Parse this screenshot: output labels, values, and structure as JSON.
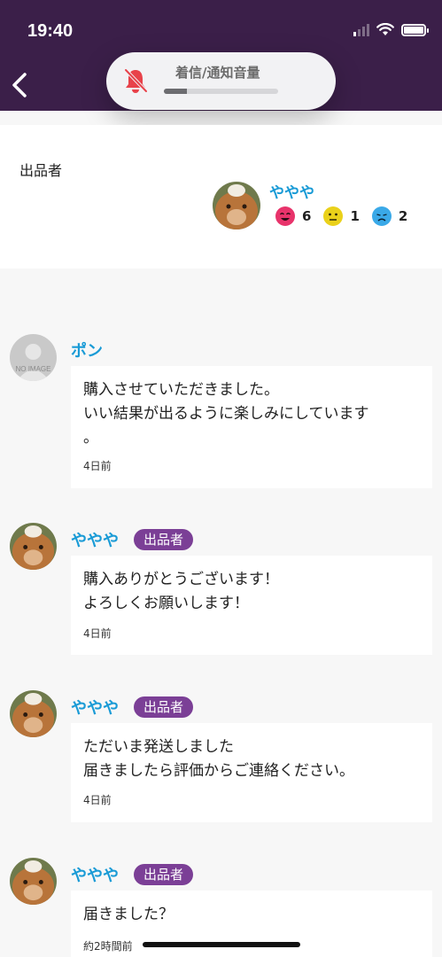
{
  "status_bar": {
    "time": "19:40"
  },
  "volume_hud": {
    "label": "着信/通知音量",
    "level": 0.2
  },
  "seller": {
    "label": "出品者",
    "name": "ややや",
    "ratings": [
      {
        "kind": "good",
        "icon": "smile-face-icon",
        "color": "#e8336b",
        "count": "6"
      },
      {
        "kind": "normal",
        "icon": "neutral-face-icon",
        "color": "#ead11a",
        "count": "1"
      },
      {
        "kind": "bad",
        "icon": "sad-face-icon",
        "color": "#3aa9e8",
        "count": "2"
      }
    ]
  },
  "messages": [
    {
      "name": "ポン",
      "badge": "",
      "avatar_text": "NO IMAGE",
      "text": "購入させていただきました。\nいい結果が出るように楽しみにしています\n。",
      "time": "4日前"
    },
    {
      "name": "ややや",
      "badge": "出品者",
      "text": "購入ありがとうございます！\nよろしくお願いします！",
      "time": "4日前"
    },
    {
      "name": "ややや",
      "badge": "出品者",
      "text": "ただいま発送しました\n届きましたら評価からご連絡ください。",
      "time": "4日前"
    },
    {
      "name": "ややや",
      "badge": "出品者",
      "text": "届きました？",
      "time": "約2時間前"
    }
  ],
  "colors": {
    "header": "#3b1f49",
    "accent_name": "#1a9bd6",
    "badge": "#7b3f96"
  }
}
